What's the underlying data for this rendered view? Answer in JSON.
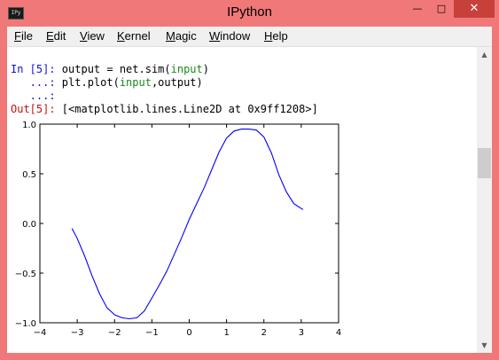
{
  "window": {
    "title": "IPython",
    "icon_label": "IPy",
    "buttons": {
      "minimize": "—",
      "maximize": "□",
      "close": "✕"
    }
  },
  "menu": {
    "items": [
      {
        "label": "File",
        "accel": "F",
        "rest": "ile"
      },
      {
        "label": "Edit",
        "accel": "E",
        "rest": "dit"
      },
      {
        "label": "View",
        "accel": "V",
        "rest": "iew"
      },
      {
        "label": "Kernel",
        "accel": "K",
        "rest": "ernel"
      },
      {
        "label": "Magic",
        "accel": "M",
        "rest": "agic"
      },
      {
        "label": "Window",
        "accel": "W",
        "rest": "indow"
      },
      {
        "label": "Help",
        "accel": "H",
        "rest": "elp"
      }
    ]
  },
  "console": {
    "in_prompt": "In [5]:",
    "line1_a": " output = net.sim(",
    "line1_kw": "input",
    "line1_b": ")",
    "cont_prompt": "   ...:",
    "line2_a": " plt.plot(",
    "line2_kw": "input",
    "line2_b": ",output)",
    "cont_prompt_empty": "   ...:",
    "out_prompt": "Out[5]:",
    "out_text": " [<matplotlib.lines.Line2D at 0x9ff1208>]"
  },
  "chart_data": {
    "type": "line",
    "title": "",
    "xlabel": "",
    "ylabel": "",
    "xlim": [
      -4,
      4
    ],
    "ylim": [
      -1.0,
      1.0
    ],
    "xticks": [
      -4,
      -3,
      -2,
      -1,
      0,
      1,
      2,
      3,
      4
    ],
    "xtick_labels": [
      "−4",
      "−3",
      "−2",
      "−1",
      "0",
      "1",
      "2",
      "3",
      "4"
    ],
    "yticks": [
      -1.0,
      -0.5,
      0.0,
      0.5,
      1.0
    ],
    "ytick_labels": [
      "−1.0",
      "−0.5",
      "0.0",
      "0.5",
      "1.0"
    ],
    "grid": false,
    "color": "#0000ff",
    "x": [
      -3.14,
      -3.0,
      -2.8,
      -2.6,
      -2.4,
      -2.2,
      -2.0,
      -1.8,
      -1.6,
      -1.4,
      -1.2,
      -1.0,
      -0.8,
      -0.6,
      -0.4,
      -0.2,
      0.0,
      0.2,
      0.4,
      0.6,
      0.8,
      1.0,
      1.2,
      1.4,
      1.6,
      1.8,
      2.0,
      2.2,
      2.4,
      2.6,
      2.8,
      3.0,
      3.05
    ],
    "y": [
      -0.05,
      -0.15,
      -0.33,
      -0.53,
      -0.71,
      -0.85,
      -0.92,
      -0.95,
      -0.96,
      -0.95,
      -0.88,
      -0.75,
      -0.62,
      -0.48,
      -0.31,
      -0.14,
      0.04,
      0.2,
      0.36,
      0.54,
      0.72,
      0.86,
      0.93,
      0.95,
      0.95,
      0.94,
      0.87,
      0.71,
      0.49,
      0.32,
      0.2,
      0.15,
      0.14
    ]
  }
}
